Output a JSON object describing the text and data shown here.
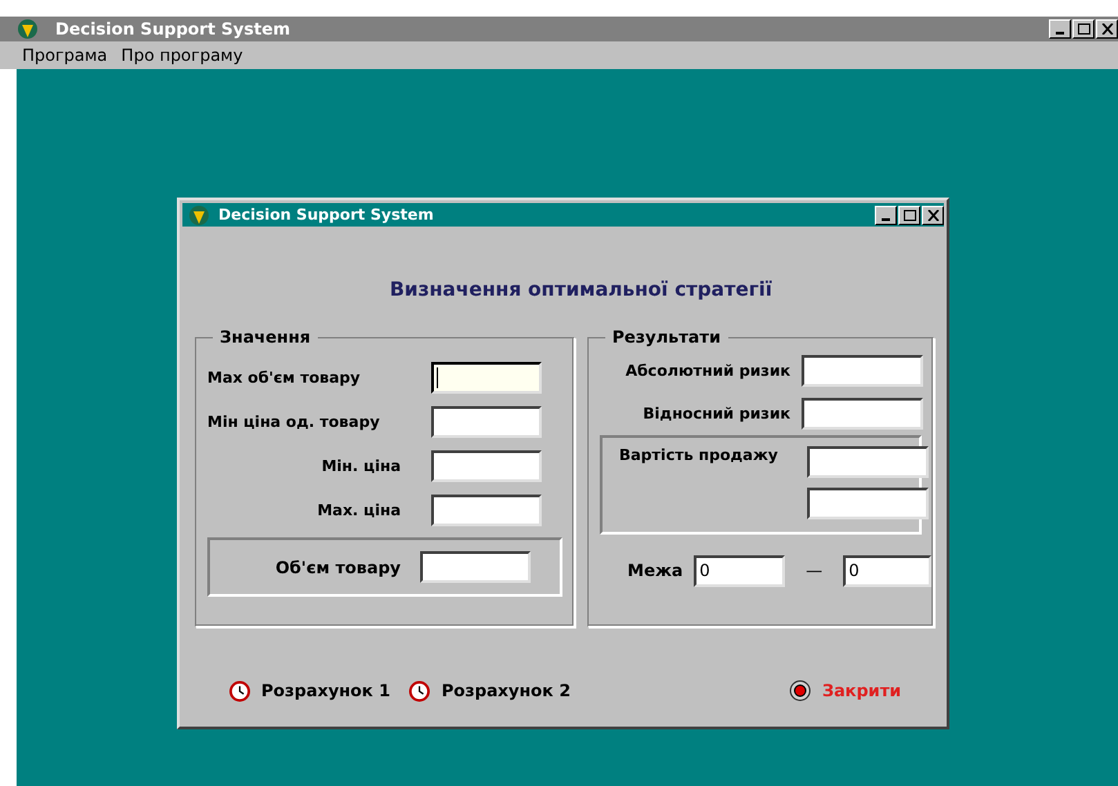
{
  "window": {
    "title": "Decision Support System"
  },
  "menu": [
    {
      "label": "Програма"
    },
    {
      "label": "Про програму"
    }
  ],
  "dialog": {
    "title": "Decision Support System",
    "heading": "Визначення оптимальної стратегії",
    "values": {
      "title": "Значення",
      "rows": [
        {
          "label": "Мах об'єм товару",
          "kind": "flush",
          "focused": true
        },
        {
          "label": "Мін ціна од. товару",
          "kind": "flush",
          "focused": false
        },
        {
          "label": "Мін. ціна",
          "kind": "indented",
          "focused": false
        },
        {
          "label": "Мах. ціна",
          "kind": "indented",
          "focused": false
        }
      ],
      "volume": {
        "label": "Об'єм товару"
      }
    },
    "results": {
      "title": "Результати",
      "rows": [
        {
          "label": "Абсолютний ризик"
        },
        {
          "label": "Відносний ризик"
        }
      ],
      "sale": {
        "label": "Вартість продажу"
      },
      "limit": {
        "label": "Межа",
        "from": "0",
        "separator": "—",
        "to": "0"
      }
    },
    "buttons": [
      {
        "label": "Розрахунок 1",
        "kind": "clock"
      },
      {
        "label": "Розрахунок 2",
        "kind": "clock"
      },
      {
        "label": "Закрити",
        "kind": "stop"
      }
    ]
  }
}
